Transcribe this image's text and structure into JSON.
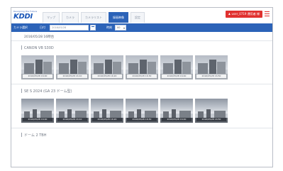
{
  "header": {
    "logo_small": "Designing the Future",
    "logo_main": "KDDI",
    "tabs": [
      "マップ",
      "カメラ",
      "カメラリスト",
      "録画映像",
      "設定"
    ],
    "active_tab_index": 3,
    "user_label": "user_0719 運用者 様",
    "accent_color": "#2c63b8",
    "user_color": "#e0312f"
  },
  "toolbar": {
    "device_label": "カメラ選択",
    "date_label": "日付",
    "date_value": "2016/05/28",
    "time_label": "時刻",
    "time_value": "00"
  },
  "main": {
    "date_heading": "2016/05/28 16時台",
    "sections": [
      {
        "title": "CANON VB S30D",
        "thumbnails": [
          "2016/05/28 16:00",
          "2016/05/28 16:10",
          "2016/05/28 16:20",
          "2016/05/28 16:30",
          "2016/05/28 16:40",
          "2016/05/28 16:50"
        ]
      },
      {
        "title": "SE S 2024 (GA 23 ドーム型)",
        "thumbnails": [
          "2016/05/28 16:00",
          "2016/05/28 16:10",
          "2016/05/28 16:20",
          "2016/05/28 16:30",
          "2016/05/28 16:40",
          "2016/05/28 16:50"
        ]
      },
      {
        "title": "ドーム 2 TBH",
        "thumbnails": []
      }
    ]
  }
}
